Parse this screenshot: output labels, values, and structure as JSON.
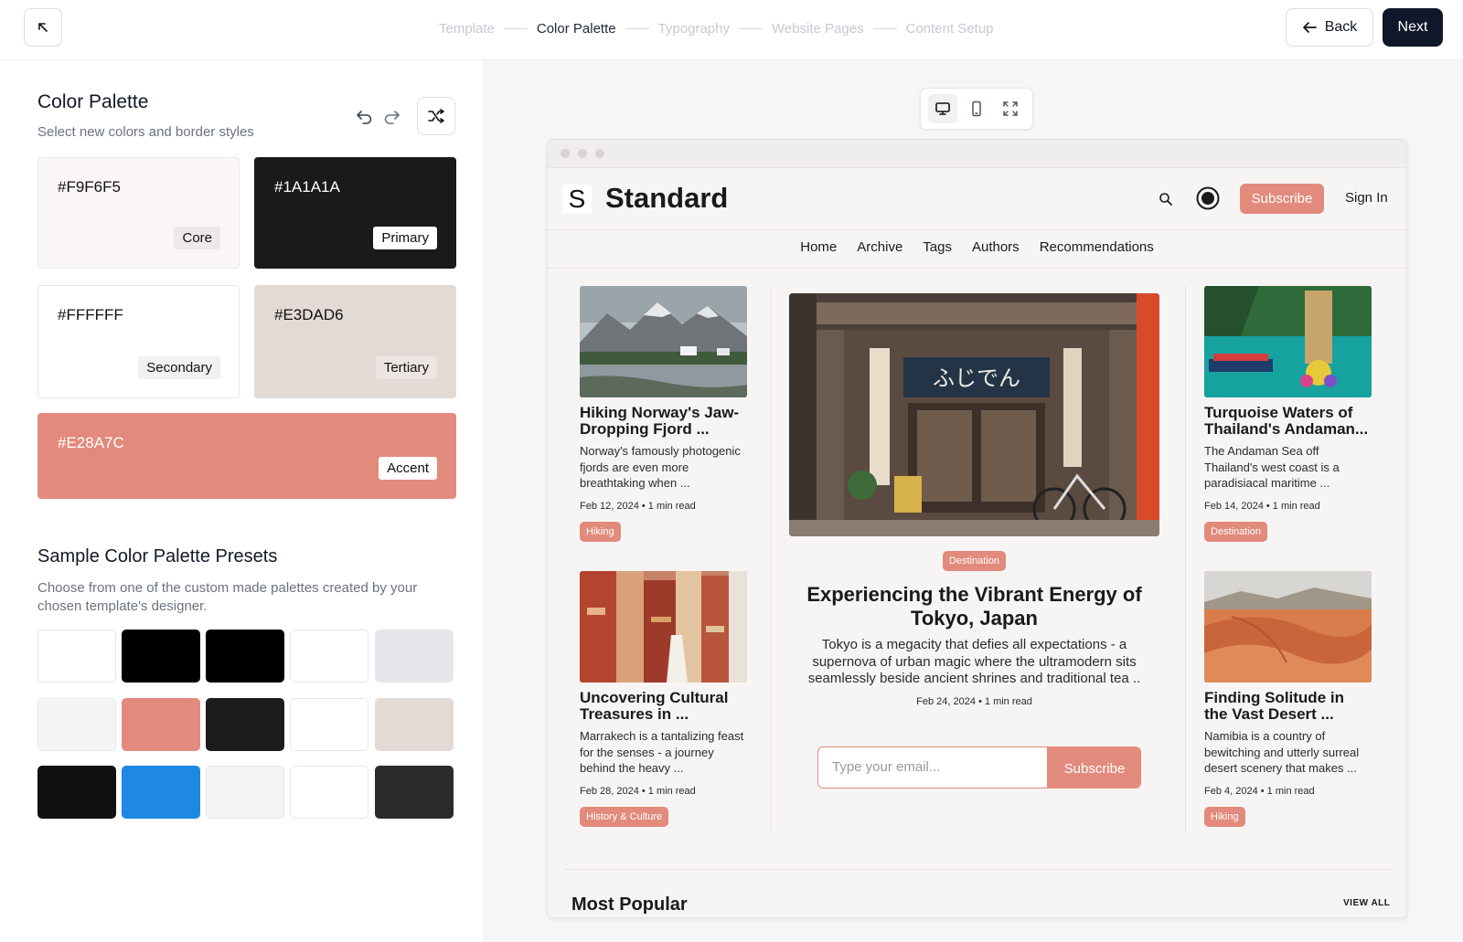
{
  "topbar": {
    "steps": [
      "Template",
      "Color Palette",
      "Typography",
      "Website Pages",
      "Content Setup"
    ],
    "active_step": "Color Palette",
    "back_label": "Back",
    "next_label": "Next"
  },
  "palette": {
    "title": "Color Palette",
    "subtitle": "Select new colors and border styles",
    "swatches": [
      {
        "hex": "#F9F6F5",
        "role": "Core",
        "color": "#F9F6F5"
      },
      {
        "hex": "#1A1A1A",
        "role": "Primary",
        "color": "#1A1A1A"
      },
      {
        "hex": "#FFFFFF",
        "role": "Secondary",
        "color": "#FFFFFF"
      },
      {
        "hex": "#E3DAD6",
        "role": "Tertiary",
        "color": "#E3DAD6"
      },
      {
        "hex": "#E28A7C",
        "role": "Accent",
        "color": "#E28A7C"
      }
    ]
  },
  "presets": {
    "title": "Sample Color Palette Presets",
    "subtitle": "Choose from one of the custom made palettes created by your chosen template's designer.",
    "rows": [
      [
        "#FFFFFF",
        "#000000",
        "#000000",
        "#FFFFFF",
        "#E5E7EB"
      ],
      [
        "#F5F5F4",
        "#E28A7C",
        "#1C1C1C",
        "#FFFFFF",
        "#E3DAD6"
      ],
      [
        "#111111",
        "#1E88E5",
        "#F3F3F3",
        "#FFFFFF",
        "#2B2B2B"
      ]
    ]
  },
  "preview": {
    "site_name": "Standard",
    "logo_letter": "S",
    "subscribe_label": "Subscribe",
    "signin_label": "Sign In",
    "nav": [
      "Home",
      "Archive",
      "Tags",
      "Authors",
      "Recommendations"
    ],
    "cards": [
      {
        "title": "Hiking Norway's Jaw-Dropping Fjord ...",
        "excerpt": "Norway's famously photogenic fjords are even more breathtaking when ...",
        "meta": "Feb 12, 2024 • 1 min read",
        "tag": "Hiking"
      },
      {
        "title": "Uncovering Cultural Treasures in ...",
        "excerpt": "Marrakech is a tantalizing feast for the senses - a journey behind the heavy ...",
        "meta": "Feb 28, 2024 • 1 min read",
        "tag": "History & Culture"
      },
      {
        "title": "Turquoise Waters of Thailand's Andaman...",
        "excerpt": "The Andaman Sea off Thailand's west coast is a paradisiacal maritime ...",
        "meta": "Feb 14, 2024 • 1 min read",
        "tag": "Destination"
      },
      {
        "title": "Finding Solitude in the Vast Desert ...",
        "excerpt": "Namibia is a country of bewitching and utterly surreal desert scenery that makes ...",
        "meta": "Feb 4, 2024 • 1 min read",
        "tag": "Hiking"
      }
    ],
    "feature": {
      "tag": "Destination",
      "title": "Experiencing the Vibrant Energy of Tokyo, Japan",
      "excerpt": "Tokyo is a megacity that defies all expectations - a supernova of urban magic where the ultramodern sits seamlessly beside ancient shrines and traditional tea ..",
      "meta": "Feb 24, 2024 • 1 min read",
      "sign_text": "ふじでん"
    },
    "email_placeholder": "Type your email...",
    "signup_button": "Subscribe",
    "popular_title": "Most Popular",
    "view_all": "VIEW ALL"
  },
  "colors": {
    "accent": "#E28A7C",
    "primary": "#1A1A1A",
    "next_button": "#0F172A"
  }
}
